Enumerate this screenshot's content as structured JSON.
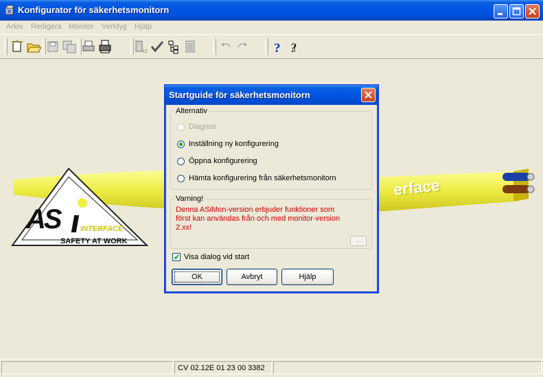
{
  "window": {
    "title": "Konfigurator för säkerhetsmonitorn",
    "icon": "app-config-icon",
    "controls": [
      "minimize-icon",
      "maximize-icon",
      "close-icon"
    ]
  },
  "menu": {
    "items": [
      "Arkiv",
      "Redigera",
      "Monitor",
      "Verktyg",
      "Hjälp"
    ]
  },
  "toolbar": {
    "icons": [
      "new-icon",
      "open-icon",
      "save-icon",
      "save-all-icon",
      "print-icon",
      "print-setup-icon",
      "monitor-download-icon",
      "verify-icon",
      "tree-icon",
      "list-icon",
      "undo-icon",
      "redo-icon",
      "help-icon",
      "context-help-icon"
    ]
  },
  "logo": {
    "text_as": "AS",
    "text_interface": "INTERFACE",
    "text_safety": "SAFETY AT WORK",
    "cable_text": "erface",
    "colors": {
      "yellow": "#f0ef3c",
      "dark": "#222222"
    }
  },
  "dialog": {
    "title": "Startguide för säkerhetsmonitorn",
    "alternativ_label": "Alternativ",
    "options": [
      {
        "label": "Diagnos",
        "selected": false,
        "disabled": true
      },
      {
        "label": "Inställning ny konfigurering",
        "selected": true,
        "disabled": false
      },
      {
        "label": "Öppna konfigurering",
        "selected": false,
        "disabled": false
      },
      {
        "label": "Hämta konfigurering från säkerhetsmonitorn",
        "selected": false,
        "disabled": false
      }
    ],
    "warning_label": "Varning!",
    "warning_text": "Denna ASiMon-version erbjuder funktioner som först kan användas från och med monitor-version 2.xx!",
    "more_button": "...",
    "checkbox_label": "Visa dialog vid start",
    "checkbox_checked": true,
    "ok_label": "OK",
    "cancel_label": "Avbryt",
    "help_label": "Hjälp"
  },
  "status": {
    "version": "CV 02.12E 01 23 00 3382"
  }
}
